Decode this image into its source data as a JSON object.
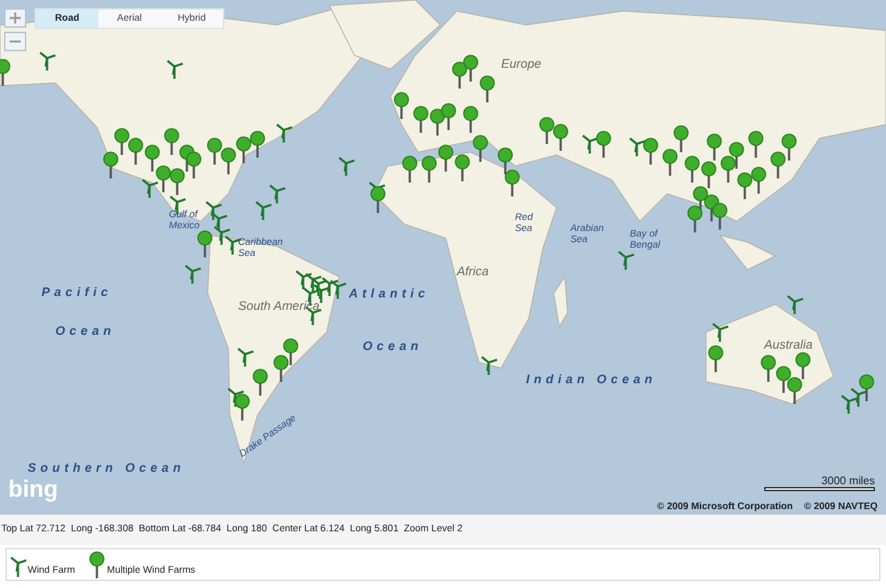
{
  "map": {
    "view_tabs": [
      {
        "label": "Road",
        "selected": true
      },
      {
        "label": "Aerial",
        "selected": false
      },
      {
        "label": "Hybrid",
        "selected": false
      }
    ],
    "labels": [
      {
        "text": "Pacific",
        "kind": "ocean"
      },
      {
        "text": "Ocean",
        "kind": "ocean"
      },
      {
        "text": "Atlantic",
        "kind": "ocean"
      },
      {
        "text": "Ocean",
        "kind": "ocean"
      },
      {
        "text": "Indian Ocean",
        "kind": "ocean"
      },
      {
        "text": "Southern Ocean",
        "kind": "ocean"
      },
      {
        "text": "South America",
        "kind": "land"
      },
      {
        "text": "Africa",
        "kind": "land"
      },
      {
        "text": "Europe",
        "kind": "land"
      },
      {
        "text": "Australia",
        "kind": "land"
      },
      {
        "text": "Gulf of Mexico",
        "kind": "sea"
      },
      {
        "text": "Caribbean Sea",
        "kind": "sea"
      },
      {
        "text": "Red Sea",
        "kind": "sea"
      },
      {
        "text": "Arabian Sea",
        "kind": "sea"
      },
      {
        "text": "Bay of Bengal",
        "kind": "sea"
      },
      {
        "text": "Drake Passage",
        "kind": "sea"
      }
    ],
    "logo": "bing",
    "scale": "3000 miles",
    "copyrights": [
      "© 2009 Microsoft Corporation",
      "© 2009 NAVTEQ"
    ]
  },
  "status_bar": "Top Lat 72.712  Long -168.308  Bottom Lat -68.784  Long 180  Center Lat 6.124  Long 5.801  Zoom Level 2",
  "legend": [
    {
      "kind": "turbine",
      "label": "Wind Farm"
    },
    {
      "kind": "pin",
      "label": "Multiple Wind Farms"
    }
  ]
}
